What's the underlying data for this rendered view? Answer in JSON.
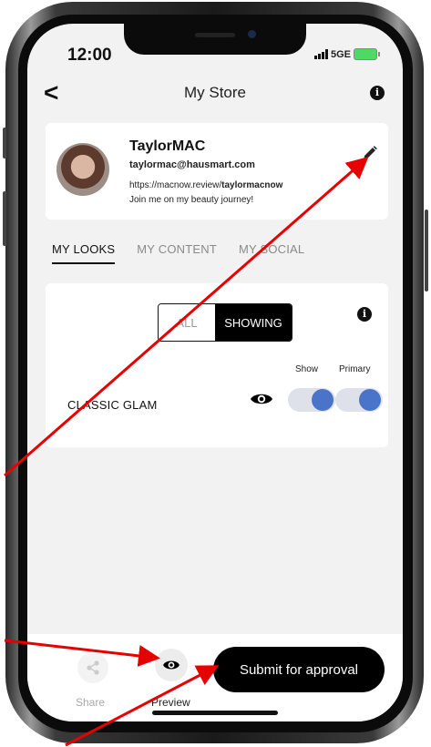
{
  "status_bar": {
    "time": "12:00",
    "network": "5GE"
  },
  "header": {
    "title": "My Store",
    "back_glyph": "<",
    "info_glyph": "i"
  },
  "profile": {
    "name": "TaylorMAC",
    "email": "taylormac@hausmart.com",
    "url_prefix": "https://macnow.review/",
    "url_handle": "taylormacnow",
    "bio": "Join me on my beauty journey!"
  },
  "tabs": [
    {
      "label": "MY LOOKS",
      "active": true
    },
    {
      "label": "MY CONTENT",
      "active": false
    },
    {
      "label": "MY SOCIAL",
      "active": false
    }
  ],
  "looks": {
    "filter_all": "ALL",
    "filter_showing": "SHOWING",
    "selected_filter": "SHOWING",
    "col_show": "Show",
    "col_primary": "Primary",
    "items": [
      {
        "name": "CLASSIC GLAM",
        "show": true,
        "primary": true
      }
    ]
  },
  "bottom": {
    "share_label": "Share",
    "preview_label": "Preview",
    "submit_label": "Submit for approval"
  },
  "colors": {
    "accent": "#4a74c9",
    "annotation": "#e60000",
    "primary_button": "#000000"
  },
  "icons": [
    "back-chevron-icon",
    "info-icon",
    "pencil-icon",
    "eye-icon",
    "share-icon"
  ]
}
